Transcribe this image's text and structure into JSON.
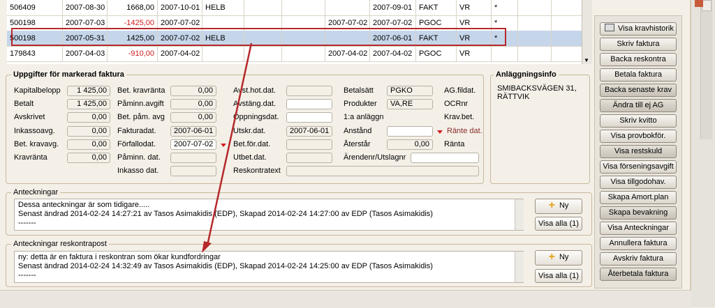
{
  "grid": {
    "rows": [
      {
        "id": "506409",
        "date": "2007-08-30",
        "amount": "1668,00",
        "due": "2007-10-01",
        "status": "HELB",
        "pay_date": "",
        "date2": "2007-09-01",
        "type": "FAKT",
        "code": "VR",
        "flag": "*"
      },
      {
        "id": "500198",
        "date": "2007-07-03",
        "amount": "-1425,00",
        "due": "2007-07-02",
        "status": "",
        "pay_date": "2007-07-02",
        "date2": "2007-07-02",
        "type": "PGOC",
        "code": "VR",
        "flag": "*"
      },
      {
        "id": "500198",
        "date": "2007-05-31",
        "amount": "1425,00",
        "due": "2007-07-02",
        "status": "HELB",
        "pay_date": "",
        "date2": "2007-06-01",
        "type": "FAKT",
        "code": "VR",
        "flag": "*"
      },
      {
        "id": "179843",
        "date": "2007-04-03",
        "amount": "-910,00",
        "due": "2007-04-02",
        "status": "",
        "pay_date": "2007-04-02",
        "date2": "2007-04-02",
        "type": "PGOC",
        "code": "VR",
        "flag": ""
      }
    ]
  },
  "invoice": {
    "title": "Uppgifter för markerad faktura",
    "col1": [
      {
        "label": "Kapitalbelopp",
        "value": "1 425,00"
      },
      {
        "label": "Betalt",
        "value": "1 425,00"
      },
      {
        "label": "Avskrivet",
        "value": "0,00"
      },
      {
        "label": "Inkassoavg.",
        "value": "0,00"
      },
      {
        "label": "Bet. kravavg.",
        "value": "0,00"
      },
      {
        "label": "Kravränta",
        "value": "0,00"
      }
    ],
    "col2": [
      {
        "label": "Bet. kravränta",
        "value": "0,00"
      },
      {
        "label": "Påminn.avgift",
        "value": "0,00"
      },
      {
        "label": "Bet. påm. avg",
        "value": "0,00"
      },
      {
        "label": "Fakturadat.",
        "value": "2007-06-01"
      },
      {
        "label": "Förfallodat.",
        "value": "2007-07-02"
      },
      {
        "label": "Påminn. dat.",
        "value": ""
      },
      {
        "label": "Inkasso dat.",
        "value": ""
      }
    ],
    "col3": [
      {
        "label": "Avst.hot.dat.",
        "value": ""
      },
      {
        "label": "Avstäng.dat.",
        "value": ""
      },
      {
        "label": "Öppningsdat.",
        "value": ""
      },
      {
        "label": "Utskr.dat.",
        "value": "2007-06-01"
      },
      {
        "label": "Bet.för.dat.",
        "value": ""
      },
      {
        "label": "Utbet.dat.",
        "value": ""
      },
      {
        "label": "Reskontratext",
        "value": ""
      }
    ],
    "col4": [
      {
        "label": "Betalsätt",
        "value": "PGKO"
      },
      {
        "label": "Produkter",
        "value": "VA,RE"
      },
      {
        "label": "1:a anläggn",
        "value": ""
      },
      {
        "label": "Anstånd",
        "value": ""
      },
      {
        "label": "Återstår",
        "value": "0,00"
      },
      {
        "label": "Ärendenr/Utslagnr",
        "value": ""
      }
    ],
    "col5": [
      {
        "label": "AG.fildat."
      },
      {
        "label": "OCRnr"
      },
      {
        "label": "Krav.bet."
      },
      {
        "label": "Ränte dat."
      },
      {
        "label": "Ränta"
      }
    ]
  },
  "facility": {
    "title": "Anläggningsinfo",
    "line1": "SMIBACKSVÄGEN 31,",
    "line2": "RÄTTVIK"
  },
  "notes": {
    "title": "Anteckningar",
    "line1": "Dessa anteckningar är som tidigare.....",
    "line2": "Senast ändrad 2014-02-24 14:27:21 av Tasos Asimakidis (EDP), Skapad 2014-02-24 14:27:00 av EDP (Tasos Asimakidis)",
    "line3": "-------",
    "new_label": "Ny",
    "show_all_label": "Visa alla (1)"
  },
  "ledger_notes": {
    "title": "Anteckningar reskontrapost",
    "line1": "ny: detta är en faktura i reskontran som ökar kundfordringar",
    "line2": "Senast ändrad 2014-02-24 14:32:49 av Tasos Asimakidis (EDP), Skapad 2014-02-24 14:25:00 av EDP (Tasos Asimakidis)",
    "line3": "-------",
    "new_label": "Ny",
    "show_all_label": "Visa alla (1)"
  },
  "actions": [
    "Visa kravhistorik",
    "Skriv faktura",
    "Backa reskontra",
    "Betala faktura",
    "Backa senaste krav",
    "Ändra till ej AG",
    "Skriv kvitto",
    "Visa provbokför.",
    "Visa restskuld",
    "Visa förseningsavgift",
    "Visa tillgodohav.",
    "Skapa Amort.plan",
    "Skapa bevakning",
    "Visa Anteckningar",
    "Annullera faktura",
    "Avskriv faktura",
    "Återbetala faktura"
  ],
  "colors": {
    "accent_red": "#b5282b",
    "negative": "#d21c1c",
    "selection": "#c6d6ea"
  }
}
